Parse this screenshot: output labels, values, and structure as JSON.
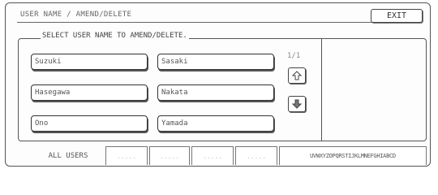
{
  "header": {
    "title": "USER NAME / AMEND/DELETE",
    "exit_label": "EXIT"
  },
  "main": {
    "prompt": "SELECT USER NAME TO AMEND/DELETE.",
    "users": [
      "Suzuki",
      "Sasaki",
      "Hasegawa",
      "Nakata",
      "Ono",
      "Yamada"
    ],
    "page_indicator": "1/1"
  },
  "tabs": [
    {
      "label": "ALL USERS"
    },
    {
      "label": "....."
    },
    {
      "label": "....."
    },
    {
      "label": "....."
    },
    {
      "label": "....."
    },
    {
      "label": "UVWXYZOPQRSTIJKLMNEFGHIABCD"
    }
  ],
  "icons": {
    "up": "arrow-up-icon",
    "down": "arrow-down-icon"
  }
}
